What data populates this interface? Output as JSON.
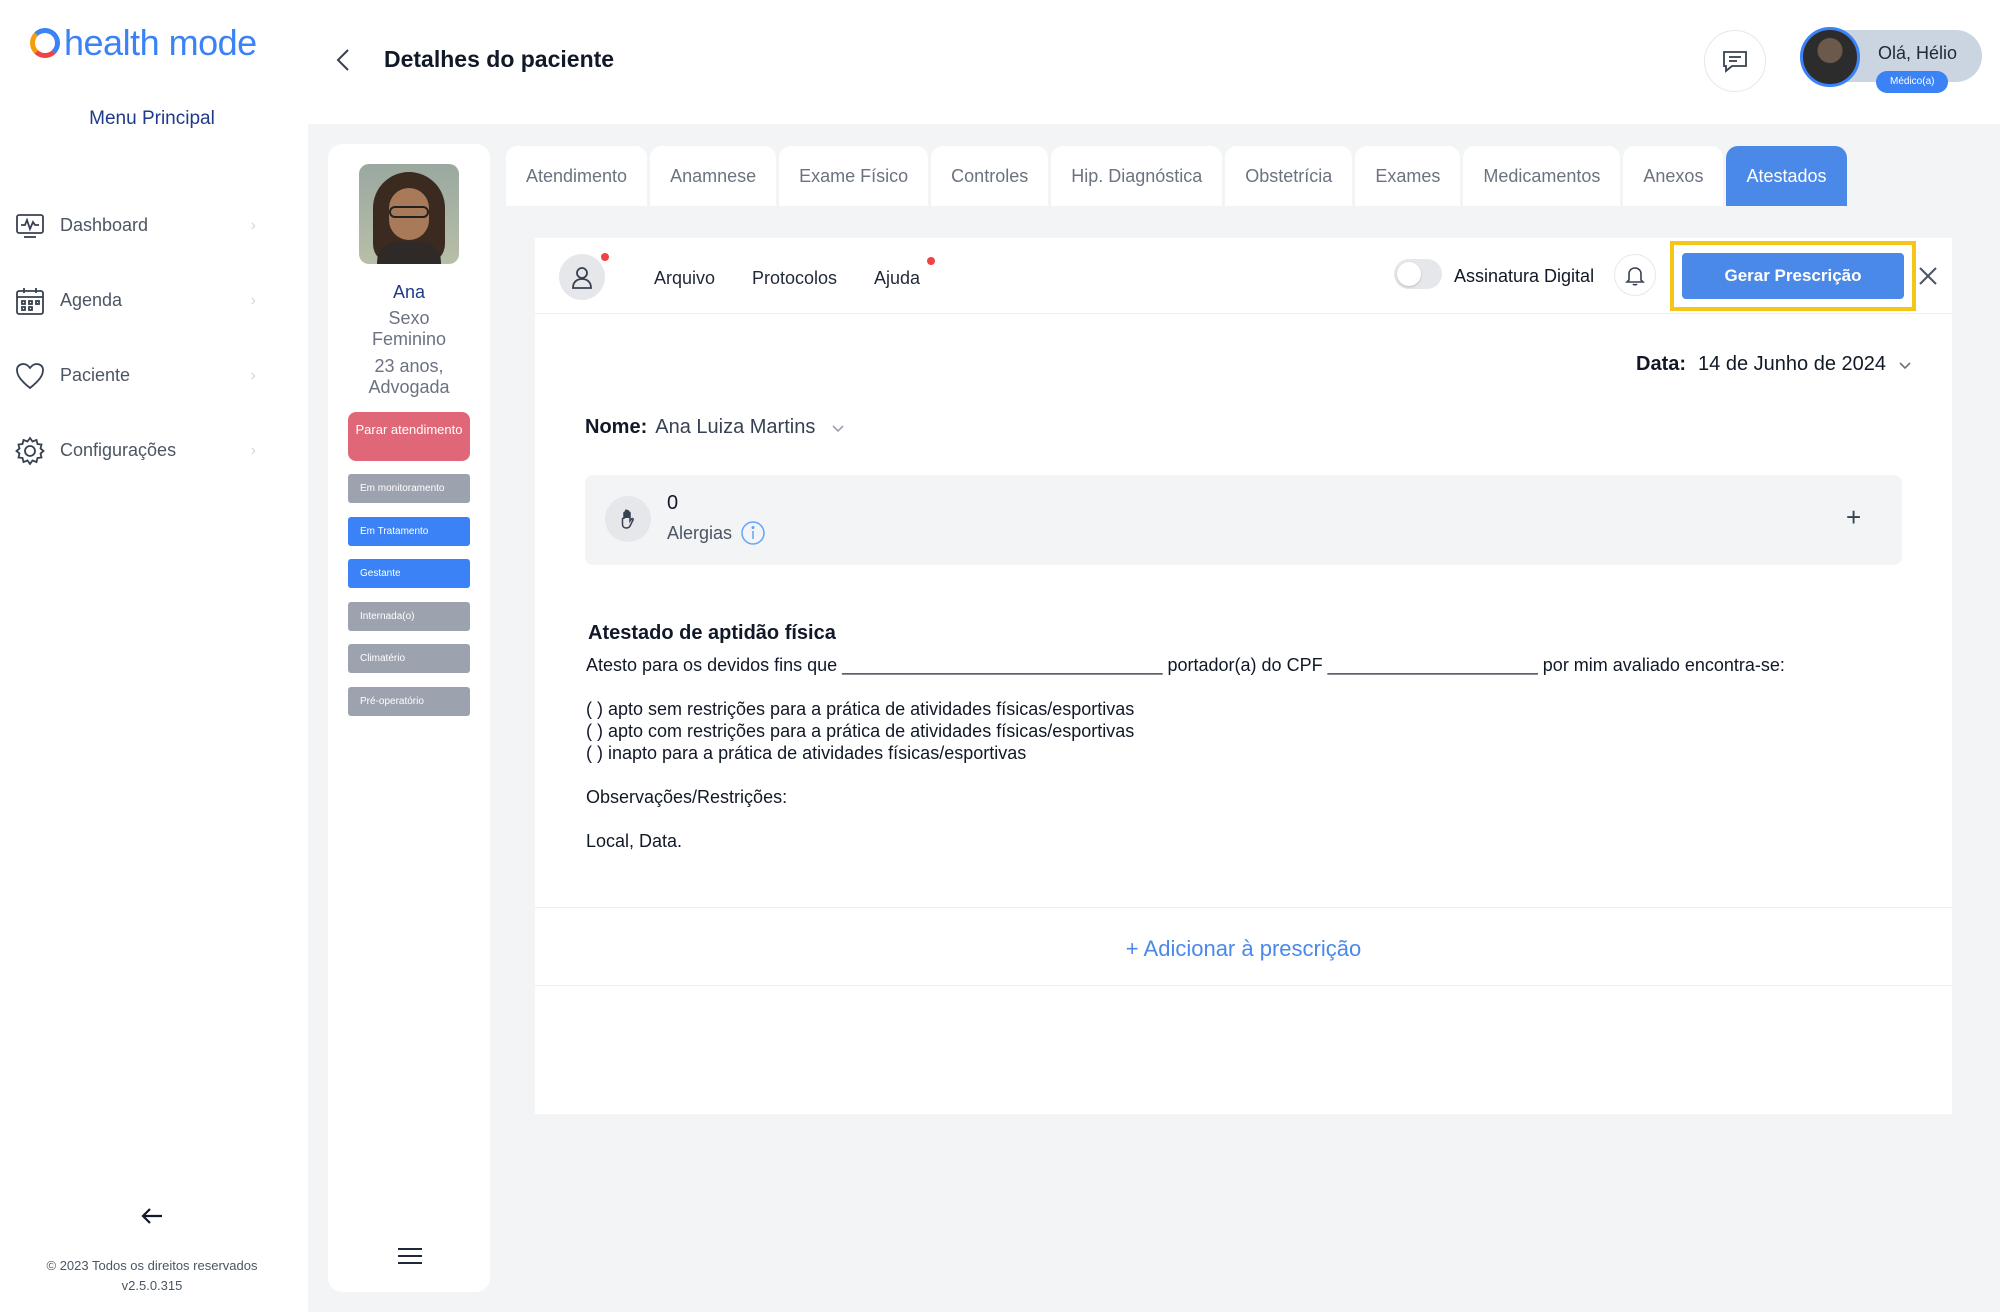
{
  "brand": {
    "logo_text": "health mode"
  },
  "sidebar": {
    "menu_title": "Menu Principal",
    "items": [
      {
        "label": "Dashboard",
        "icon": "dashboard-icon"
      },
      {
        "label": "Agenda",
        "icon": "calendar-icon"
      },
      {
        "label": "Paciente",
        "icon": "heart-icon"
      },
      {
        "label": "Configurações",
        "icon": "gear-icon"
      }
    ],
    "copyright": "© 2023 Todos os direitos reservados",
    "version": "v2.5.0.315"
  },
  "header": {
    "title": "Detalhes do paciente",
    "greeting": "Olá, Hélio",
    "role": "Médico(a)"
  },
  "patient": {
    "name": "Ana",
    "sex_label": "Sexo",
    "sex_value": "Feminino",
    "age": "23 anos,",
    "occupation": "Advogada",
    "stop_button": "Parar atendimento",
    "tags": [
      "Em monitoramento",
      "Em Tratamento",
      "Gestante",
      "Internada(o)",
      "Climatério",
      "Pré-operatório"
    ]
  },
  "tabs": [
    {
      "label": "Atendimento"
    },
    {
      "label": "Anamnese"
    },
    {
      "label": "Exame Físico"
    },
    {
      "label": "Controles"
    },
    {
      "label": "Hip. Diagnóstica"
    },
    {
      "label": "Obstetrícia"
    },
    {
      "label": "Exames"
    },
    {
      "label": "Medicamentos"
    },
    {
      "label": "Anexos"
    },
    {
      "label": "Atestados",
      "active": true
    }
  ],
  "toolbar": {
    "file": "Arquivo",
    "protocols": "Protocolos",
    "help": "Ajuda",
    "digital_signature": "Assinatura Digital",
    "generate": "Gerar Prescrição"
  },
  "form": {
    "date_label": "Data:",
    "date_value": "14 de Junho de 2024",
    "name_label": "Nome:",
    "name_value": "Ana Luiza Martins",
    "allergy_count": "0",
    "allergy_label": "Alergias"
  },
  "document": {
    "title": "Atestado de aptidão física",
    "intro": "Atesto para os devidos fins que ________________________________ portador(a) do CPF _____________________ por mim avaliado encontra-se:",
    "option1": "( ) apto sem restrições para a prática de atividades físicas/esportivas",
    "option2": "( ) apto com restrições para a prática de atividades físicas/esportivas",
    "option3": "( ) inapto para a prática de atividades físicas/esportivas",
    "observations": "Observações/Restrições:",
    "place_date": "Local, Data."
  },
  "actions": {
    "add_prescription": "+ Adicionar à prescrição"
  },
  "colors": {
    "primary": "#4a89e8",
    "highlight": "#f5c518",
    "stop": "#e06777"
  }
}
